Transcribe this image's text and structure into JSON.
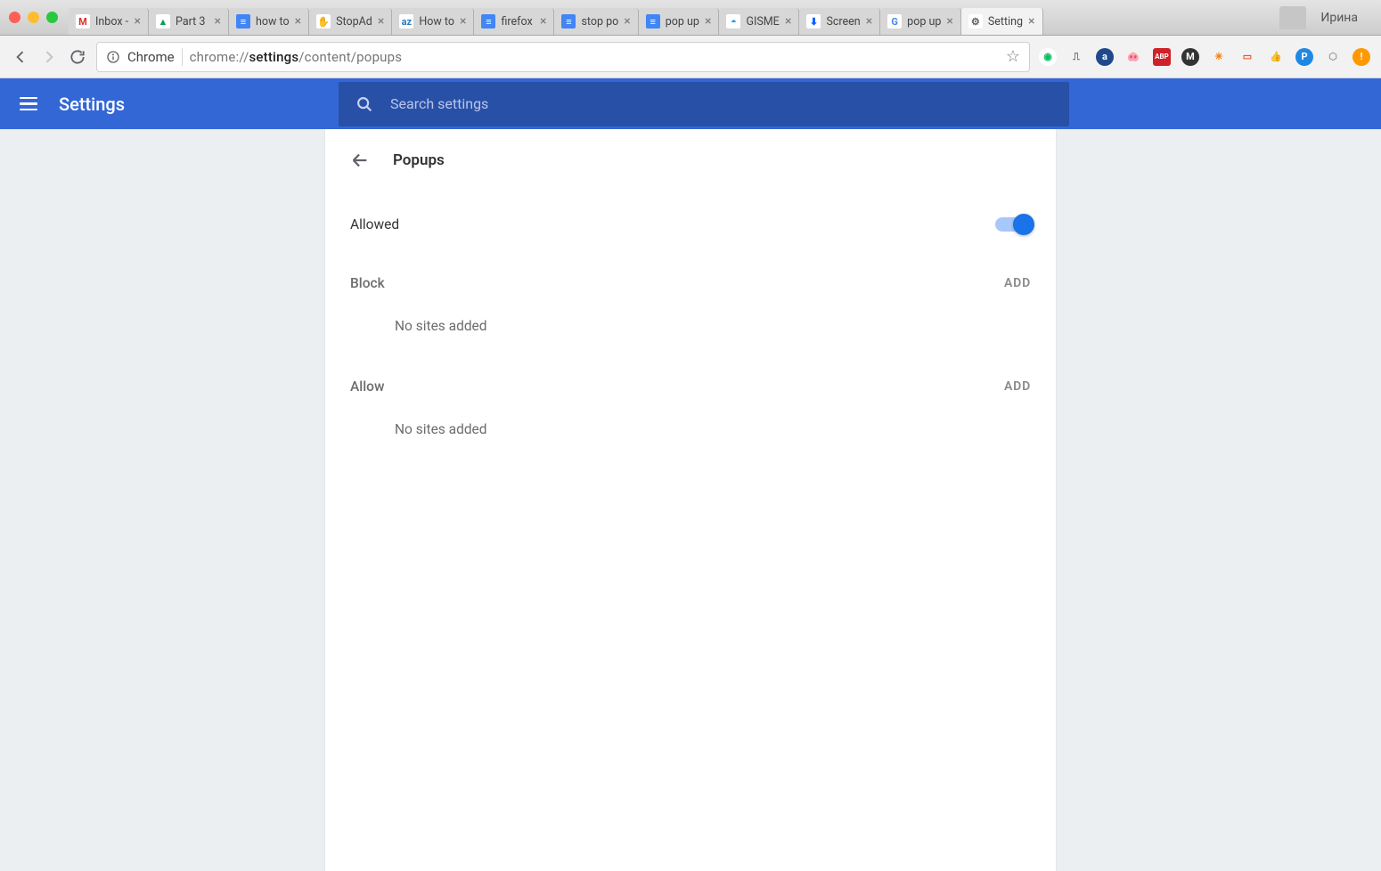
{
  "window": {
    "profile_name": "Ирина",
    "tabs": [
      {
        "label": "Inbox -",
        "favicon": "M",
        "fav_bg": "#fff",
        "fav_color": "#d93025"
      },
      {
        "label": "Part 3",
        "favicon": "▲",
        "fav_bg": "#fff",
        "fav_color": "#0f9d58"
      },
      {
        "label": "how to",
        "favicon": "≡",
        "fav_bg": "#4285f4",
        "fav_color": "#fff"
      },
      {
        "label": "StopAd",
        "favicon": "✋",
        "fav_bg": "#fff",
        "fav_color": "#e8420b"
      },
      {
        "label": "How to",
        "favicon": "az",
        "fav_bg": "#fff",
        "fav_color": "#2678c4"
      },
      {
        "label": "firefox",
        "favicon": "≡",
        "fav_bg": "#4285f4",
        "fav_color": "#fff"
      },
      {
        "label": "stop po",
        "favicon": "≡",
        "fav_bg": "#4285f4",
        "fav_color": "#fff"
      },
      {
        "label": "pop up",
        "favicon": "≡",
        "fav_bg": "#4285f4",
        "fav_color": "#fff"
      },
      {
        "label": "GISME",
        "favicon": "◓",
        "fav_bg": "#fff",
        "fav_color": "#0097e6"
      },
      {
        "label": "Screen",
        "favicon": "⬇",
        "fav_bg": "#fff",
        "fav_color": "#0061ff"
      },
      {
        "label": "pop up",
        "favicon": "G",
        "fav_bg": "#fff",
        "fav_color": "#4285f4"
      },
      {
        "label": "Setting",
        "favicon": "⚙",
        "fav_bg": "#fff",
        "fav_color": "#5f6368",
        "active": true
      }
    ]
  },
  "toolbar": {
    "chrome_label": "Chrome",
    "url_prefix": "chrome://",
    "url_bold": "settings",
    "url_suffix": "/content/popups"
  },
  "extensions": [
    {
      "glyph": "◉",
      "bg": "#fff",
      "color": "#0bbd5f"
    },
    {
      "glyph": "⎍",
      "bg": "transparent",
      "color": "#5f6368"
    },
    {
      "glyph": "a",
      "bg": "#1e4a8b",
      "color": "#fff"
    },
    {
      "glyph": "🐽",
      "bg": "transparent",
      "color": "#f4b8b8"
    },
    {
      "glyph": "ABP",
      "bg": "#d22028",
      "color": "#fff"
    },
    {
      "glyph": "M",
      "bg": "#333",
      "color": "#fff"
    },
    {
      "glyph": "✳",
      "bg": "transparent",
      "color": "#f57c00"
    },
    {
      "glyph": "▭",
      "bg": "transparent",
      "color": "#f4511e"
    },
    {
      "glyph": "👍",
      "bg": "transparent",
      "color": "#777"
    },
    {
      "glyph": "P",
      "bg": "#1e88e5",
      "color": "#fff"
    },
    {
      "glyph": "⬡",
      "bg": "transparent",
      "color": "#999"
    },
    {
      "glyph": "!",
      "bg": "#ff9800",
      "color": "#fff"
    }
  ],
  "header": {
    "title": "Settings",
    "search_placeholder": "Search settings"
  },
  "page": {
    "title": "Popups",
    "allowed_label": "Allowed",
    "block": {
      "title": "Block",
      "add": "ADD",
      "empty": "No sites added"
    },
    "allow": {
      "title": "Allow",
      "add": "ADD",
      "empty": "No sites added"
    }
  }
}
